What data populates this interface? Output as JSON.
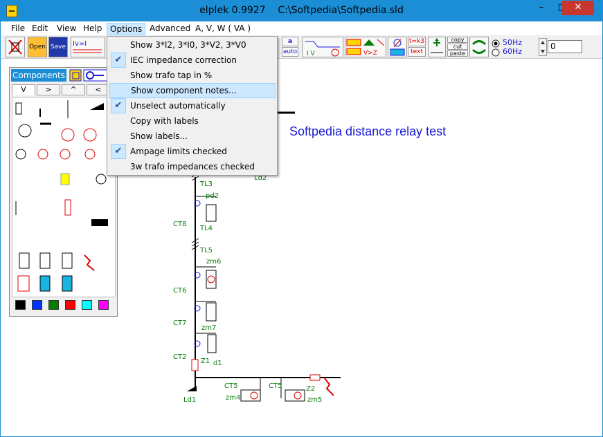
{
  "window": {
    "title": "elplek 0.9927",
    "path": "C:\\Softpedia\\Softpedia.sld"
  },
  "title_buttons": {
    "minimize": "–",
    "maximize": "□",
    "close": "✕"
  },
  "menubar": [
    {
      "label": "File"
    },
    {
      "label": "Edit"
    },
    {
      "label": "View"
    },
    {
      "label": "Help"
    },
    {
      "label": "Options"
    },
    {
      "label": "Advanced"
    },
    {
      "label": "A, V, W ( VA )"
    }
  ],
  "toolbar": {
    "open_label": "Open",
    "save_label": "Save",
    "a_label": "a",
    "auto_label": "auto",
    "copy_label": "copy",
    "cut_label": "cut",
    "paste_label": "paste",
    "text_label": "text",
    "ratio_label": "t=k3",
    "freq_50": "50Hz",
    "freq_60": "60Hz",
    "value": "0"
  },
  "options_menu": [
    {
      "label": "Show 3*I2, 3*I0, 3*V2, 3*V0",
      "checked": false
    },
    {
      "label": "IEC impedance correction",
      "checked": true
    },
    {
      "label": "Show trafo tap in %",
      "checked": false
    },
    {
      "label": "Show component notes...",
      "checked": false,
      "highlighted": true
    },
    {
      "label": "Unselect automatically",
      "checked": true
    },
    {
      "label": "Copy with labels",
      "checked": false
    },
    {
      "label": "Show labels...",
      "checked": false
    },
    {
      "label": "Ampage limits checked",
      "checked": true
    },
    {
      "label": "3w trafo impedances checked",
      "checked": false
    }
  ],
  "palette": {
    "title": "Components",
    "tabs": [
      "V",
      ">",
      "^",
      "<"
    ],
    "colors": [
      "#000000",
      "#0033ff",
      "#008000",
      "#ff0000",
      "#00ffff",
      "#ff00ff"
    ]
  },
  "drawing": {
    "title": "Softpedia distance relay test",
    "labels": [
      "Ld2",
      "TL3",
      "pd2",
      "CT8",
      "TL4",
      "TL5",
      "zm6",
      "CT6",
      "CT7",
      "zm7",
      "CT2",
      "Z1",
      "d1",
      "CT5",
      "CT5",
      "Z2",
      "Ld1",
      "zm4",
      "zm5"
    ]
  }
}
